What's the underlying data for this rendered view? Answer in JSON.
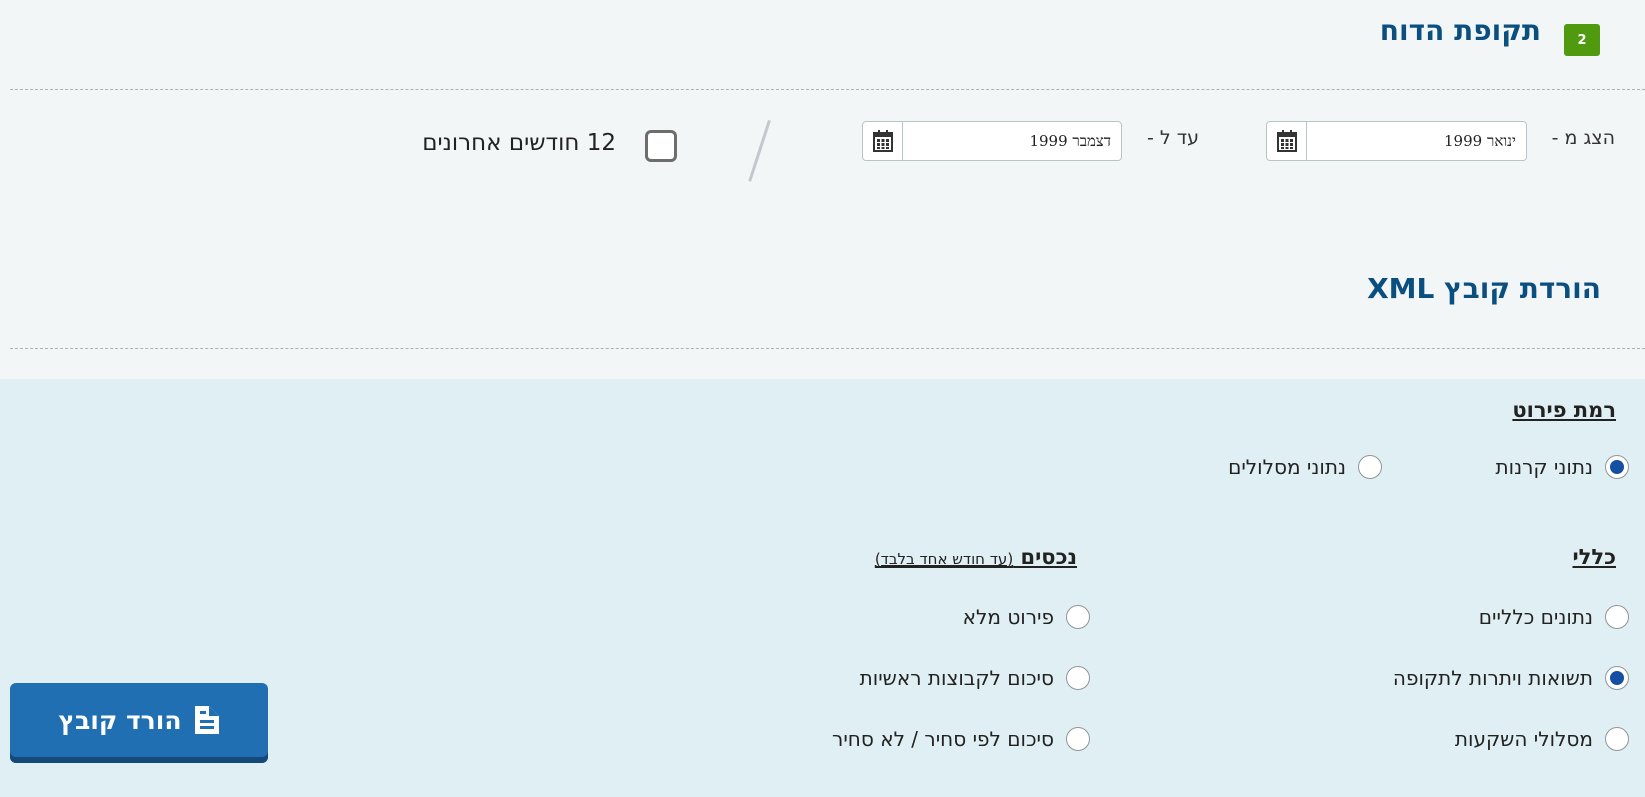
{
  "report_period": {
    "step_number": "2",
    "title": "תקופת הדוח",
    "from_label": "הצג מ -",
    "from_value": "ינואר 1999",
    "to_label": "עד ל -",
    "to_value": "דצמבר 1999",
    "last_12_months_label": "12 חודשים אחרונים",
    "last_12_months_checked": false
  },
  "xml_section": {
    "title": "הורדת קובץ XML"
  },
  "detail_level": {
    "title": "רמת פירוט",
    "options": [
      {
        "label": "נתוני קרנות",
        "checked": true
      },
      {
        "label": "נתוני מסלולים",
        "checked": false
      }
    ]
  },
  "general": {
    "title": "כללי",
    "options": [
      {
        "label": "נתונים כלליים",
        "checked": false
      },
      {
        "label": "תשואות ויתרות לתקופה",
        "checked": true
      },
      {
        "label": "מסלולי השקעות",
        "checked": false
      }
    ]
  },
  "assets": {
    "title": "נכסים",
    "subtitle": "(עד חודש אחד בלבד)",
    "options": [
      {
        "label": "פירוט מלא",
        "checked": false
      },
      {
        "label": "סיכום לקבוצות ראשיות",
        "checked": false
      },
      {
        "label": "סיכום לפי סחיר / לא סחיר",
        "checked": false
      }
    ]
  },
  "download_button": {
    "label": "הורד קובץ",
    "icon": "file-download-icon"
  },
  "colors": {
    "brand_blue": "#1f6fb2",
    "title_blue": "#0b4f80",
    "badge_green": "#4f9a0e",
    "radio_selected": "#144fa3"
  }
}
